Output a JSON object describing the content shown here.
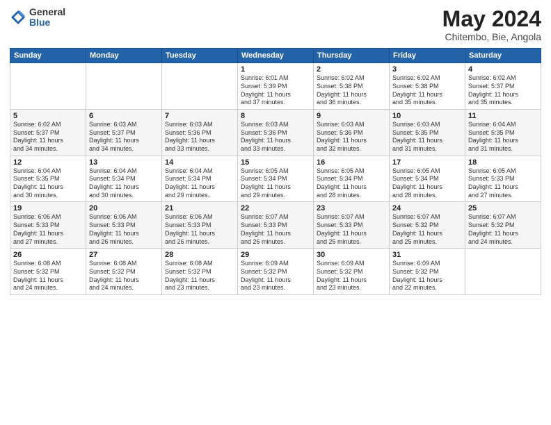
{
  "logo": {
    "general": "General",
    "blue": "Blue"
  },
  "title": {
    "month": "May 2024",
    "location": "Chitembo, Bie, Angola"
  },
  "headers": [
    "Sunday",
    "Monday",
    "Tuesday",
    "Wednesday",
    "Thursday",
    "Friday",
    "Saturday"
  ],
  "weeks": [
    [
      {
        "day": "",
        "info": ""
      },
      {
        "day": "",
        "info": ""
      },
      {
        "day": "",
        "info": ""
      },
      {
        "day": "1",
        "info": "Sunrise: 6:01 AM\nSunset: 5:39 PM\nDaylight: 11 hours\nand 37 minutes."
      },
      {
        "day": "2",
        "info": "Sunrise: 6:02 AM\nSunset: 5:38 PM\nDaylight: 11 hours\nand 36 minutes."
      },
      {
        "day": "3",
        "info": "Sunrise: 6:02 AM\nSunset: 5:38 PM\nDaylight: 11 hours\nand 35 minutes."
      },
      {
        "day": "4",
        "info": "Sunrise: 6:02 AM\nSunset: 5:37 PM\nDaylight: 11 hours\nand 35 minutes."
      }
    ],
    [
      {
        "day": "5",
        "info": "Sunrise: 6:02 AM\nSunset: 5:37 PM\nDaylight: 11 hours\nand 34 minutes."
      },
      {
        "day": "6",
        "info": "Sunrise: 6:03 AM\nSunset: 5:37 PM\nDaylight: 11 hours\nand 34 minutes."
      },
      {
        "day": "7",
        "info": "Sunrise: 6:03 AM\nSunset: 5:36 PM\nDaylight: 11 hours\nand 33 minutes."
      },
      {
        "day": "8",
        "info": "Sunrise: 6:03 AM\nSunset: 5:36 PM\nDaylight: 11 hours\nand 33 minutes."
      },
      {
        "day": "9",
        "info": "Sunrise: 6:03 AM\nSunset: 5:36 PM\nDaylight: 11 hours\nand 32 minutes."
      },
      {
        "day": "10",
        "info": "Sunrise: 6:03 AM\nSunset: 5:35 PM\nDaylight: 11 hours\nand 31 minutes."
      },
      {
        "day": "11",
        "info": "Sunrise: 6:04 AM\nSunset: 5:35 PM\nDaylight: 11 hours\nand 31 minutes."
      }
    ],
    [
      {
        "day": "12",
        "info": "Sunrise: 6:04 AM\nSunset: 5:35 PM\nDaylight: 11 hours\nand 30 minutes."
      },
      {
        "day": "13",
        "info": "Sunrise: 6:04 AM\nSunset: 5:34 PM\nDaylight: 11 hours\nand 30 minutes."
      },
      {
        "day": "14",
        "info": "Sunrise: 6:04 AM\nSunset: 5:34 PM\nDaylight: 11 hours\nand 29 minutes."
      },
      {
        "day": "15",
        "info": "Sunrise: 6:05 AM\nSunset: 5:34 PM\nDaylight: 11 hours\nand 29 minutes."
      },
      {
        "day": "16",
        "info": "Sunrise: 6:05 AM\nSunset: 5:34 PM\nDaylight: 11 hours\nand 28 minutes."
      },
      {
        "day": "17",
        "info": "Sunrise: 6:05 AM\nSunset: 5:34 PM\nDaylight: 11 hours\nand 28 minutes."
      },
      {
        "day": "18",
        "info": "Sunrise: 6:05 AM\nSunset: 5:33 PM\nDaylight: 11 hours\nand 27 minutes."
      }
    ],
    [
      {
        "day": "19",
        "info": "Sunrise: 6:06 AM\nSunset: 5:33 PM\nDaylight: 11 hours\nand 27 minutes."
      },
      {
        "day": "20",
        "info": "Sunrise: 6:06 AM\nSunset: 5:33 PM\nDaylight: 11 hours\nand 26 minutes."
      },
      {
        "day": "21",
        "info": "Sunrise: 6:06 AM\nSunset: 5:33 PM\nDaylight: 11 hours\nand 26 minutes."
      },
      {
        "day": "22",
        "info": "Sunrise: 6:07 AM\nSunset: 5:33 PM\nDaylight: 11 hours\nand 26 minutes."
      },
      {
        "day": "23",
        "info": "Sunrise: 6:07 AM\nSunset: 5:33 PM\nDaylight: 11 hours\nand 25 minutes."
      },
      {
        "day": "24",
        "info": "Sunrise: 6:07 AM\nSunset: 5:32 PM\nDaylight: 11 hours\nand 25 minutes."
      },
      {
        "day": "25",
        "info": "Sunrise: 6:07 AM\nSunset: 5:32 PM\nDaylight: 11 hours\nand 24 minutes."
      }
    ],
    [
      {
        "day": "26",
        "info": "Sunrise: 6:08 AM\nSunset: 5:32 PM\nDaylight: 11 hours\nand 24 minutes."
      },
      {
        "day": "27",
        "info": "Sunrise: 6:08 AM\nSunset: 5:32 PM\nDaylight: 11 hours\nand 24 minutes."
      },
      {
        "day": "28",
        "info": "Sunrise: 6:08 AM\nSunset: 5:32 PM\nDaylight: 11 hours\nand 23 minutes."
      },
      {
        "day": "29",
        "info": "Sunrise: 6:09 AM\nSunset: 5:32 PM\nDaylight: 11 hours\nand 23 minutes."
      },
      {
        "day": "30",
        "info": "Sunrise: 6:09 AM\nSunset: 5:32 PM\nDaylight: 11 hours\nand 23 minutes."
      },
      {
        "day": "31",
        "info": "Sunrise: 6:09 AM\nSunset: 5:32 PM\nDaylight: 11 hours\nand 22 minutes."
      },
      {
        "day": "",
        "info": ""
      }
    ]
  ]
}
